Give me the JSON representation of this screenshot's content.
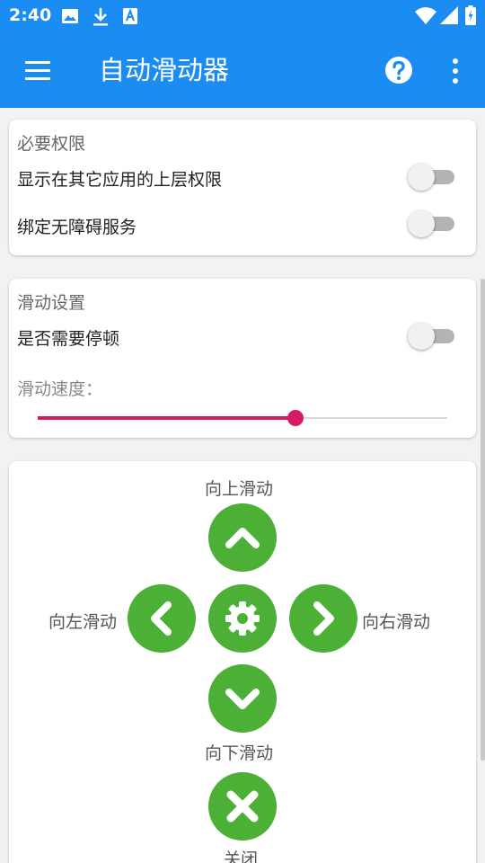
{
  "status_bar": {
    "time": "2:40",
    "left_icons": [
      "image-icon",
      "download-icon",
      "a-text-icon"
    ],
    "right_icons": [
      "wifi-icon",
      "signal-icon",
      "battery-icon"
    ]
  },
  "app_bar": {
    "title": "自动滑动器",
    "icons": [
      "menu-icon",
      "help-icon",
      "more-vert-icon"
    ],
    "color": "#1a8cf2"
  },
  "permissions": {
    "title": "必要权限",
    "items": [
      {
        "label": "显示在其它应用的上层权限",
        "enabled": false
      },
      {
        "label": "绑定无障碍服务",
        "enabled": false
      }
    ]
  },
  "swipe_settings": {
    "title": "滑动设置",
    "pause": {
      "label": "是否需要停顿",
      "enabled": false
    },
    "speed": {
      "label": "滑动速度：",
      "value": 0.63
    }
  },
  "controls": {
    "up_label": "向上滑动",
    "left_label": "向左滑动",
    "right_label": "向右滑动",
    "down_label": "向下滑动",
    "close_label": "关闭",
    "button_color": "#4caf36",
    "icons": [
      "chevron-up-icon",
      "chevron-left-icon",
      "gear-icon",
      "chevron-right-icon",
      "chevron-down-icon",
      "close-icon"
    ]
  },
  "colors": {
    "accent": "#d81b60",
    "primary": "#1a8cf2"
  }
}
